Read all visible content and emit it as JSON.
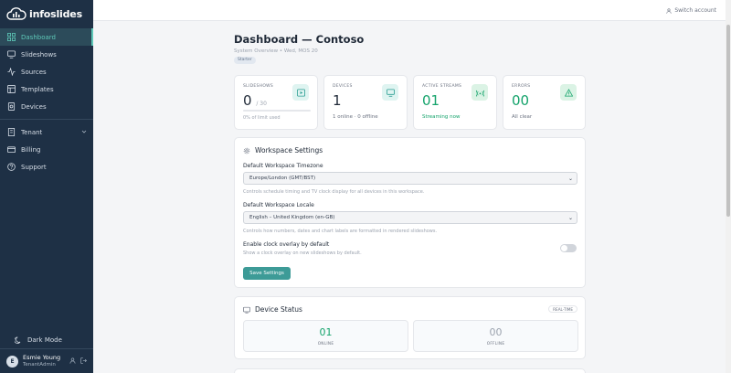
{
  "brand": {
    "name": "infoslides",
    "accent": "#5ec8b8",
    "sidebar_bg": "#1e3045"
  },
  "sidebar": {
    "items": [
      {
        "label": "Dashboard",
        "icon": "grid-icon",
        "active": true
      },
      {
        "label": "Slideshows",
        "icon": "monitor-icon"
      },
      {
        "label": "Sources",
        "icon": "activity-icon"
      },
      {
        "label": "Templates",
        "icon": "template-icon"
      },
      {
        "label": "Devices",
        "icon": "device-icon"
      }
    ],
    "tenant_label": "Tenant",
    "billing_label": "Billing",
    "support_label": "Support",
    "dark_mode_label": "Dark Mode"
  },
  "user": {
    "initial": "E",
    "name": "Esmie Young",
    "role": "TenantAdmin"
  },
  "topbar": {
    "switch_account": "Switch account"
  },
  "page": {
    "title": "Dashboard — Contoso",
    "subtitle": "System Overview • Wed, MOS 20",
    "plan_badge": "Starter"
  },
  "stats": [
    {
      "label": "SLIDESHOWS",
      "value": "0",
      "suffix": "/ 30",
      "sub": "0% of limit used",
      "progress": 0
    },
    {
      "label": "DEVICES",
      "value": "1",
      "sub": "1 online · 0 offline"
    },
    {
      "label": "ACTIVE STREAMS",
      "value": "01",
      "sub": "Streaming now"
    },
    {
      "label": "ERRORS",
      "value": "00",
      "sub": "All clear"
    }
  ],
  "workspace": {
    "title": "Workspace Settings",
    "timezone_label": "Default Workspace Timezone",
    "timezone_value": "Europe/London (GMT/BST)",
    "timezone_help": "Controls schedule timing and TV clock display for all devices in this workspace.",
    "locale_label": "Default Workspace Locale",
    "locale_value": "English – United Kingdom (en-GB)",
    "locale_help": "Controls how numbers, dates and chart labels are formatted in rendered slideshows.",
    "clock_label": "Enable clock overlay by default",
    "clock_help": "Show a clock overlay on new slideshows by default.",
    "clock_enabled": false,
    "save_label": "Save Settings"
  },
  "device_status": {
    "title": "Device Status",
    "badge": "REAL-TIME",
    "online_value": "01",
    "online_label": "ONLINE",
    "offline_value": "00",
    "offline_label": "OFFLINE"
  }
}
